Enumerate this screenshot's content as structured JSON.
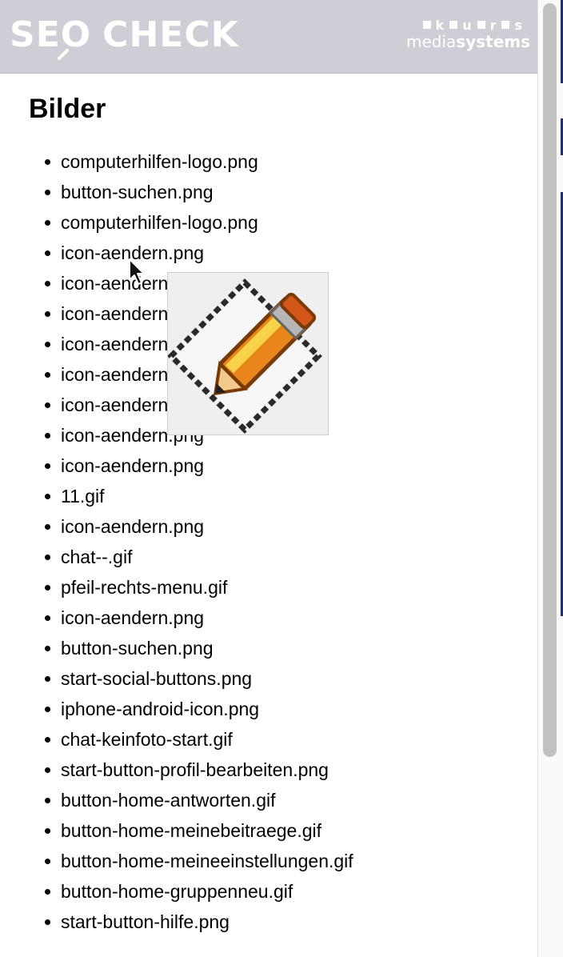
{
  "header": {
    "brand_left": "SEO",
    "brand_right": "CHECK",
    "partner_squares": [
      "k",
      "u",
      "r",
      "s"
    ],
    "partner_name_light": "media",
    "partner_name_bold": "systems"
  },
  "main": {
    "title": "Bilder",
    "images": [
      "computerhilfen-logo.png",
      "button-suchen.png",
      "computerhilfen-logo.png",
      "icon-aendern.png",
      "icon-aendern.png",
      "icon-aendern.png",
      "icon-aendern.png",
      "icon-aendern.png",
      "icon-aendern.png",
      "icon-aendern.png",
      "icon-aendern.png",
      "11.gif",
      "icon-aendern.png",
      "chat--.gif",
      "pfeil-rechts-menu.gif",
      "icon-aendern.png",
      "button-suchen.png",
      "start-social-buttons.png",
      "iphone-android-icon.png",
      "chat-keinfoto-start.gif",
      "start-button-profil-bearbeiten.png",
      "button-home-antworten.gif",
      "button-home-meinebeitraege.gif",
      "button-home-meineeinstellungen.gif",
      "button-home-gruppenneu.gif",
      "start-button-hilfe.png"
    ]
  },
  "tooltip": {
    "icon": "pencil-edit-icon"
  },
  "colors": {
    "header_bg": "#cdced6",
    "accent_navy": "#1f2f7a",
    "pencil_orange": "#e8861c"
  }
}
